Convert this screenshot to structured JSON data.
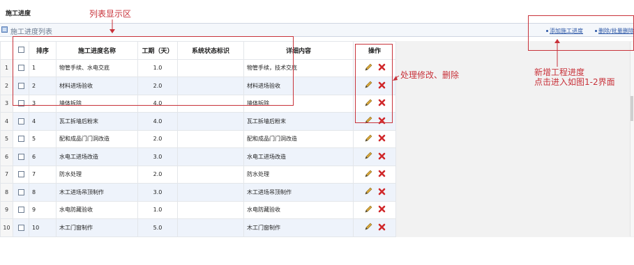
{
  "page": {
    "title": "施工进度"
  },
  "panel": {
    "label": "施工进度列表",
    "add_link": "添加施工进度",
    "delete_link": "删除/批量删除"
  },
  "table": {
    "headers": {
      "order": "排序",
      "name": "施工进度名称",
      "period": "工期（天）",
      "status": "系统状态标识",
      "detail": "详细内容",
      "ops": "操作"
    },
    "rows": [
      {
        "num": "1",
        "order": "1",
        "name": "物管手续、水电交底",
        "period": "1.0",
        "status": "",
        "detail": "物管手续，技术交底"
      },
      {
        "num": "2",
        "order": "2",
        "name": "材料进场验收",
        "period": "2.0",
        "status": "",
        "detail": "材料进场验收"
      },
      {
        "num": "3",
        "order": "3",
        "name": "墙体拆除",
        "period": "4.0",
        "status": "",
        "detail": "墙体拆除"
      },
      {
        "num": "4",
        "order": "4",
        "name": "瓦工拆墙后粉末",
        "period": "4.0",
        "status": "",
        "detail": "瓦工拆墙后粉末"
      },
      {
        "num": "5",
        "order": "5",
        "name": "配和成品门门洞改造",
        "period": "2.0",
        "status": "",
        "detail": "配和成品门门洞改造"
      },
      {
        "num": "6",
        "order": "6",
        "name": "水电工进场改造",
        "period": "3.0",
        "status": "",
        "detail": "水电工进场改造"
      },
      {
        "num": "7",
        "order": "7",
        "name": "防水处理",
        "period": "2.0",
        "status": "",
        "detail": "防水处理"
      },
      {
        "num": "8",
        "order": "8",
        "name": "木工进场吊顶制作",
        "period": "3.0",
        "status": "",
        "detail": "木工进场吊顶制作"
      },
      {
        "num": "9",
        "order": "9",
        "name": "水电防藏验收",
        "period": "1.0",
        "status": "",
        "detail": "水电防藏验收"
      },
      {
        "num": "10",
        "order": "10",
        "name": "木工门窗制作",
        "period": "5.0",
        "status": "",
        "detail": "木工门窗制作"
      }
    ]
  },
  "annotations": {
    "list_area": "列表显示区",
    "ops_note": "处理修改、删除",
    "add_note_line1": "新增工程进度",
    "add_note_line2": "点击进入如图1-2界面"
  },
  "colors": {
    "annotation": "#c8323a",
    "link": "#2b56a6",
    "row_alt": "#eef3fb",
    "edit_icon": "#d9a83a",
    "delete_icon": "#d0272a"
  },
  "icons": {
    "edit": "pencil-icon",
    "delete": "close-icon",
    "panel": "list-icon"
  }
}
